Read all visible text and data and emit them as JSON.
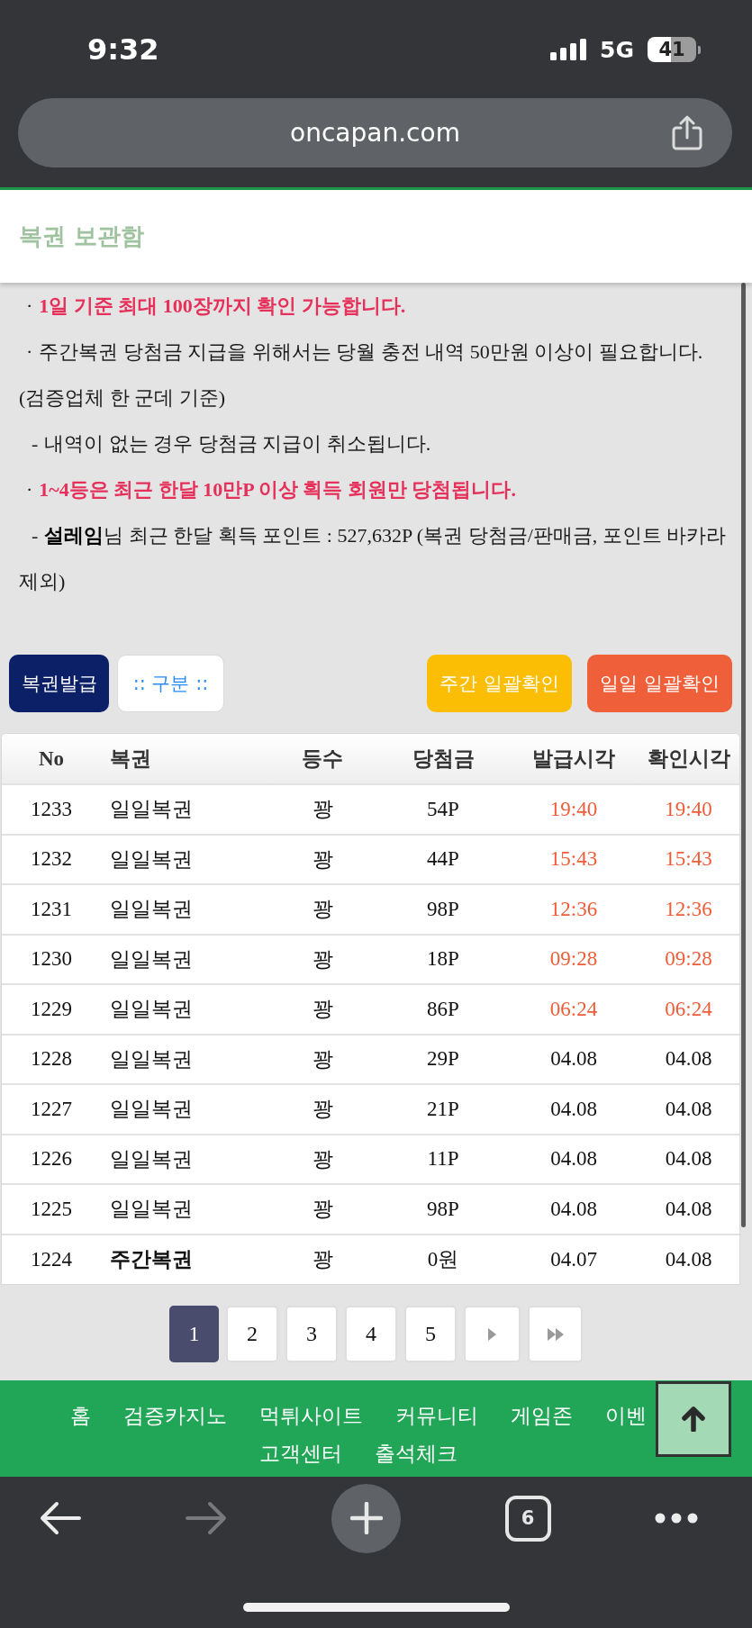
{
  "status_bar": {
    "time": "9:32",
    "network": "5G",
    "battery": "41"
  },
  "address_bar": {
    "url": "oncapan.com"
  },
  "page_title": "복권 보관함",
  "notices": [
    {
      "kind": "bullet",
      "marker": "·",
      "text": "1일 기준 최대 100장까지 확인 가능합니다.",
      "emphasis": true
    },
    {
      "kind": "bullet",
      "marker": "·",
      "text": "주간복권 당첨금 지급을 위해서는 당월 충전 내역 50만원 이상이 필요합니다. (검증업체 한 군데 기준)",
      "emphasis": false
    },
    {
      "kind": "sub",
      "marker": "-",
      "text": "내역이 없는 경우 당첨금 지급이 취소됩니다.",
      "emphasis": false
    },
    {
      "kind": "bullet",
      "marker": "·",
      "text": "1~4등은 최근 한달 10만P 이상 획득 회원만 당첨됩니다.",
      "emphasis": true
    },
    {
      "kind": "sub",
      "marker": "-",
      "text": "**설레임**님 최근 한달 획득 포인트 : 527,632P (복권 당첨금/판매금, 포인트 바카라 제외)",
      "emphasis": false
    }
  ],
  "actions": [
    {
      "kind": "issue",
      "label": "복권발급"
    },
    {
      "kind": "select",
      "label": ":: 구분 ::"
    },
    {
      "kind": "weekly",
      "label": "주간 일괄확인"
    },
    {
      "kind": "daily",
      "label": "일일 일괄확인"
    }
  ],
  "table": {
    "columns": [
      "No",
      "복권",
      "등수",
      "당첨금",
      "발급시각",
      "확인시각"
    ],
    "rows": [
      {
        "no": "1233",
        "ticket": "일일복권",
        "kind": "daily",
        "rank": "꽝",
        "prize": "54P",
        "issued": "19:40",
        "checked": "19:40",
        "highlighted": true
      },
      {
        "no": "1232",
        "ticket": "일일복권",
        "kind": "daily",
        "rank": "꽝",
        "prize": "44P",
        "issued": "15:43",
        "checked": "15:43",
        "highlighted": true
      },
      {
        "no": "1231",
        "ticket": "일일복권",
        "kind": "daily",
        "rank": "꽝",
        "prize": "98P",
        "issued": "12:36",
        "checked": "12:36",
        "highlighted": true
      },
      {
        "no": "1230",
        "ticket": "일일복권",
        "kind": "daily",
        "rank": "꽝",
        "prize": "18P",
        "issued": "09:28",
        "checked": "09:28",
        "highlighted": true
      },
      {
        "no": "1229",
        "ticket": "일일복권",
        "kind": "daily",
        "rank": "꽝",
        "prize": "86P",
        "issued": "06:24",
        "checked": "06:24",
        "highlighted": true
      },
      {
        "no": "1228",
        "ticket": "일일복권",
        "kind": "daily",
        "rank": "꽝",
        "prize": "29P",
        "issued": "04.08",
        "checked": "04.08",
        "highlighted": false
      },
      {
        "no": "1227",
        "ticket": "일일복권",
        "kind": "daily",
        "rank": "꽝",
        "prize": "21P",
        "issued": "04.08",
        "checked": "04.08",
        "highlighted": false
      },
      {
        "no": "1226",
        "ticket": "일일복권",
        "kind": "daily",
        "rank": "꽝",
        "prize": "11P",
        "issued": "04.08",
        "checked": "04.08",
        "highlighted": false
      },
      {
        "no": "1225",
        "ticket": "일일복권",
        "kind": "daily",
        "rank": "꽝",
        "prize": "98P",
        "issued": "04.08",
        "checked": "04.08",
        "highlighted": false
      },
      {
        "no": "1224",
        "ticket": "주간복권",
        "kind": "weekly",
        "rank": "꽝",
        "prize": "0원",
        "issued": "04.07",
        "checked": "04.08",
        "highlighted": false
      }
    ]
  },
  "pagination": {
    "pages": [
      {
        "label": "1",
        "selected": true
      },
      {
        "label": "2",
        "selected": false
      },
      {
        "label": "3",
        "selected": false
      },
      {
        "label": "4",
        "selected": false
      },
      {
        "label": "5",
        "selected": false
      }
    ]
  },
  "footer_nav": [
    "홈",
    "검증카지노",
    "먹튀사이트",
    "커뮤니티",
    "게임존",
    "이벤",
    "고객센터",
    "출석체크"
  ],
  "browser_toolbar": {
    "nav_buttons": [
      {
        "kind": "back",
        "disabled": false
      },
      {
        "kind": "forward",
        "disabled": true
      }
    ],
    "tab_count": "6"
  }
}
